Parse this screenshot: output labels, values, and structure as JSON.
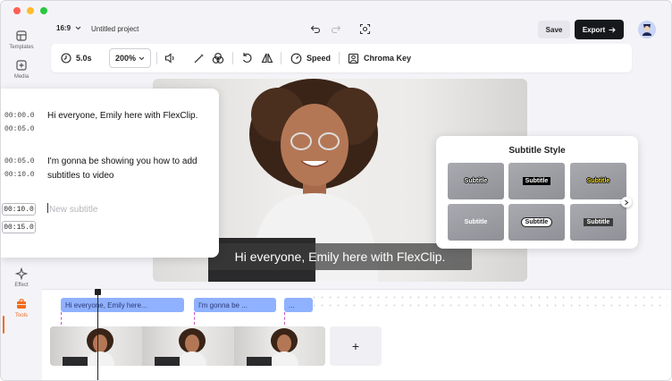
{
  "window": {
    "buttons": [
      "close",
      "minimize",
      "maximize"
    ]
  },
  "sidebar": {
    "items": [
      {
        "label": "Templates",
        "icon": "templates-icon"
      },
      {
        "label": "Media",
        "icon": "media-icon"
      },
      {
        "label": "Effect",
        "icon": "effect-icon"
      },
      {
        "label": "Tools",
        "icon": "tools-icon",
        "active": true
      }
    ],
    "accent_color": "#f26a1b"
  },
  "topbar": {
    "aspect_ratio": "16:9",
    "project_title": "Untitled project",
    "save_label": "Save",
    "export_label": "Export"
  },
  "toolbar": {
    "duration": "5.0s",
    "zoom": "200%",
    "speed_label": "Speed",
    "chroma_key_label": "Chroma Key"
  },
  "canvas": {
    "subtitle_text": "Hi everyone, Emily here with FlexClip."
  },
  "subtitles_panel": {
    "entries": [
      {
        "start": "00:00.0",
        "end": "00:05.0",
        "text": "Hi everyone, Emily here with FlexClip."
      },
      {
        "start": "00:05.0",
        "end": "00:10.0",
        "text": "I'm gonna be showing you how to add subtitles to video"
      },
      {
        "start": "00:10.0",
        "end": "00:15.0",
        "placeholder": "New subtitle"
      }
    ]
  },
  "subtitle_style": {
    "title": "Subtitle Style",
    "tiles": [
      {
        "label": "Subtitle",
        "style": "outline"
      },
      {
        "label": "Subtitle",
        "style": "boxed"
      },
      {
        "label": "Subtitle",
        "style": "yellow"
      },
      {
        "label": "Subtitle",
        "style": "plain"
      },
      {
        "label": "Subtitle",
        "style": "pill"
      },
      {
        "label": "Subtitle",
        "style": "dark"
      }
    ]
  },
  "timeline": {
    "clips": [
      {
        "label": "Hi everyone, Emily here..."
      },
      {
        "label": "I'm gonna be ..."
      },
      {
        "label": "..."
      }
    ],
    "add_label": "+",
    "clip_color": "#8fb1ff"
  }
}
